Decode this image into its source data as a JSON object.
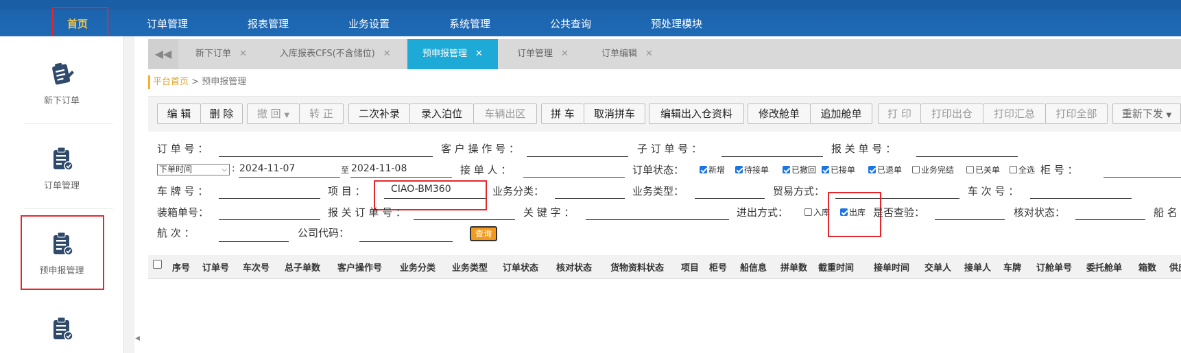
{
  "nav": [
    "首页",
    "订单管理",
    "报表管理",
    "业务设置",
    "系统管理",
    "公共查询",
    "预处理模块"
  ],
  "sidebar": [
    {
      "label": "新下订单",
      "icon": "clipboard-pen-icon"
    },
    {
      "label": "订单管理",
      "icon": "clipboard-check-icon"
    },
    {
      "label": "预申报管理",
      "icon": "clipboard-check-icon"
    }
  ],
  "tabs": [
    "新下订单",
    "入库报表CFS(不含储位)",
    "预申报管理",
    "订单管理",
    "订单编辑"
  ],
  "active_tab": "预申报管理",
  "breadcrumb": {
    "home": "平台首页",
    "sep": " > ",
    "current": "预申报管理"
  },
  "toolbar": [
    "编 辑",
    "删 除",
    "撤 回",
    "转 正",
    "二次补录",
    "录入泊位",
    "车辆出区",
    "拼 车",
    "取消拼车",
    "编辑出入仓资料",
    "修改舱单",
    "追加舱单",
    "打 印",
    "打印出仓",
    "打印汇总",
    "打印全部",
    "重新下发"
  ],
  "form": {
    "order_no": "订 单 号 ：",
    "customer_op_no": "客 户 操 作 号 ：",
    "sub_order_no": "子 订 单 号 ：",
    "customs_no": "报 关 单 号 ：",
    "time_select": "下单时间",
    "date_from": "2024-11-07",
    "date_to_label": "至",
    "date_to": "2024-11-08",
    "receiver": "接 单 人 ：",
    "order_status": "订单状态：",
    "cabinet_no": "柜 号 ：",
    "plate_no": "车 牌 号 ：",
    "project": "项 目 ：",
    "project_value": "CIAO-BM360",
    "biz_category": "业务分类：",
    "biz_type": "业务类型：",
    "trade_mode": "贸易方式：",
    "trip_no": "车 次 号 ：",
    "packing_no": "装箱单号：",
    "customs_order_no": "报 关 订 单 号 ：",
    "keyword": "关 键 字 ：",
    "in_out_mode": "进出方式：",
    "inspection": "是否查验：",
    "verify_status": "核对状态：",
    "ship_name": "船 名",
    "voyage": "航 次 ：",
    "company_code": "公司代码：",
    "query": "查询"
  },
  "status_checks": [
    {
      "label": "新增",
      "checked": true
    },
    {
      "label": "待接单",
      "checked": true
    },
    {
      "label": "已撤回",
      "checked": true
    },
    {
      "label": "已接单",
      "checked": true
    },
    {
      "label": "已退单",
      "checked": true
    },
    {
      "label": "业务完结",
      "checked": false
    },
    {
      "label": "已关单",
      "checked": false
    },
    {
      "label": "全选",
      "checked": false
    }
  ],
  "inout_checks": [
    {
      "label": "入库",
      "checked": false
    },
    {
      "label": "出库",
      "checked": true
    }
  ],
  "columns": [
    "序号",
    "订单号",
    "车次号",
    "总子单数",
    "客户操作号",
    "业务分类",
    "业务类型",
    "订单状态",
    "核对状态",
    "货物资料状态",
    "项目",
    "柜号",
    "船信息",
    "拼单数",
    "截重时间",
    "接单时间",
    "交单人",
    "接单人",
    "车牌",
    "订舱单号",
    "委托舱单",
    "箱数",
    "供应"
  ]
}
